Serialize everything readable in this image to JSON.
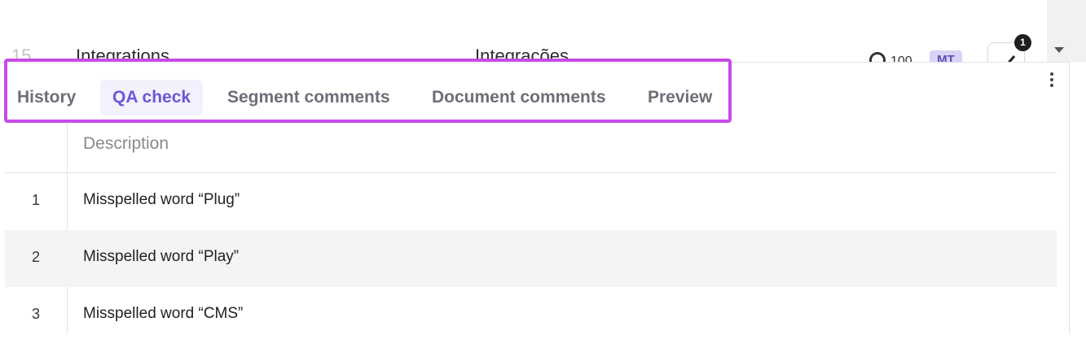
{
  "segment": {
    "number": "15",
    "source": "Integrations",
    "target": "Integrações",
    "match_score": "100",
    "mt_badge": "MT",
    "notification_count": "1"
  },
  "tabs": [
    {
      "label": "History",
      "active": false
    },
    {
      "label": "QA check",
      "active": true
    },
    {
      "label": "Segment comments",
      "active": false
    },
    {
      "label": "Document comments",
      "active": false
    },
    {
      "label": "Preview",
      "active": false
    }
  ],
  "qa_table": {
    "header_description": "Description",
    "rows": [
      {
        "num": "1",
        "description": "Misspelled word “Plug”"
      },
      {
        "num": "2",
        "description": "Misspelled word “Play”"
      },
      {
        "num": "3",
        "description": "Misspelled word “CMS”"
      }
    ]
  },
  "colors": {
    "highlight_border": "#c64be8",
    "active_tab": "#6b57d6",
    "mt_badge_bg": "#d9d3f7"
  }
}
